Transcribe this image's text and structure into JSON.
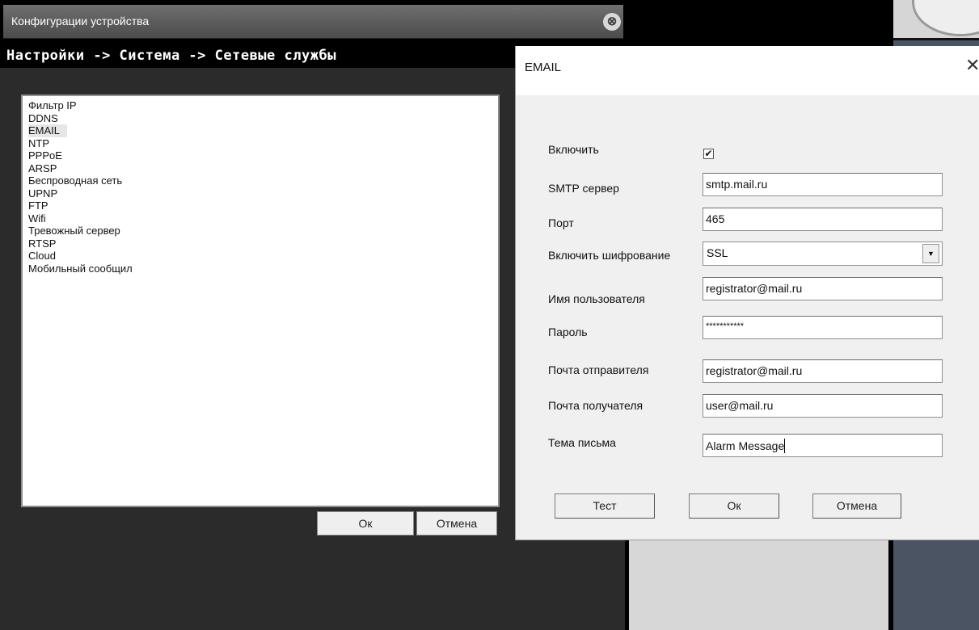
{
  "bg_window": {
    "title": "Конфигурации устройства",
    "close_glyph": "⊗",
    "breadcrumb": "Настройки -> Система -> Сетевые службы",
    "services": [
      "Фильтр IP",
      "DDNS",
      "EMAIL",
      "NTP",
      "PPPoE",
      "ARSP",
      "Беспроводная сеть",
      "UPNP",
      "FTP",
      "Wifi",
      "Тревожный сервер",
      "RTSP",
      "Cloud",
      "Мобильный сообщил"
    ],
    "selected_service": "EMAIL",
    "ok_label": "Ок",
    "cancel_label": "Отмена"
  },
  "dialog": {
    "title": "EMAIL",
    "close_glyph": "✕",
    "enable_label": "Включить",
    "enable_checked": true,
    "check_glyph": "✔",
    "smtp_label": "SMTP сервер",
    "smtp_value": "smtp.mail.ru",
    "port_label": "Порт",
    "port_value": "465",
    "encryption_label": "Включить шифрование",
    "encryption_value": "SSL",
    "dropdown_glyph": "▼",
    "username_label": "Имя пользователя",
    "username_value": "registrator@mail.ru",
    "password_label": "Пароль",
    "password_value": "***********",
    "sender_label": "Почта отправителя",
    "sender_value": "registrator@mail.ru",
    "recipient_label": "Почта получателя",
    "recipient_value": "user@mail.ru",
    "subject_label": "Тема письма",
    "subject_value": "Alarm Message",
    "test_label": "Тест",
    "ok_label": "Ок",
    "cancel_label": "Отмена"
  },
  "colors": {
    "titlebar": "#5e5e5e",
    "panel": "#2b2b2b",
    "dialog_bg": "#f0f0f0",
    "side_panel": "#4a5462"
  }
}
